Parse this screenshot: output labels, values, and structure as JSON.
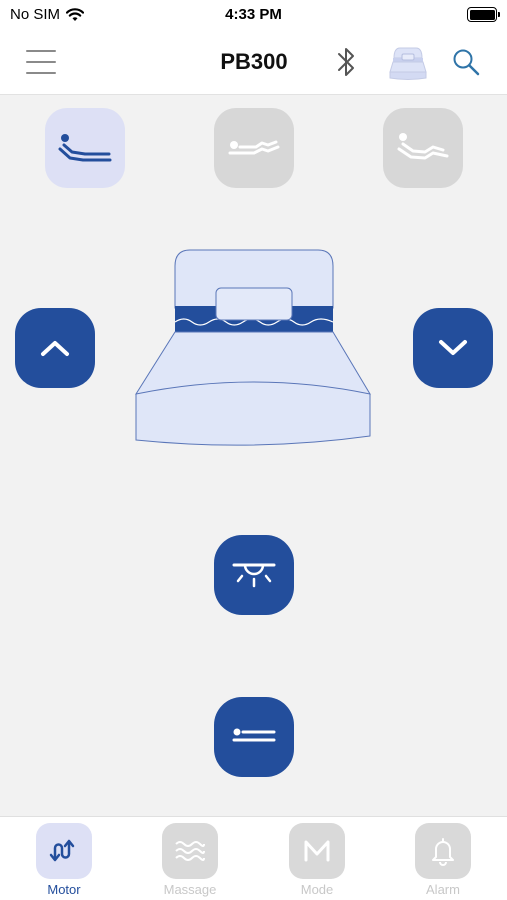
{
  "status_bar": {
    "carrier": "No SIM",
    "time": "4:33 PM",
    "wifi_icon": "wifi-icon",
    "battery_icon": "battery-icon"
  },
  "header": {
    "title": "PB300",
    "menu_icon": "hamburger-icon",
    "bluetooth_icon": "bluetooth-icon",
    "bed_icon": "bed-status-icon",
    "search_icon": "search-icon"
  },
  "presets": [
    {
      "icon": "flat-lying-person-icon",
      "state": "active"
    },
    {
      "icon": "zero-gravity-icon",
      "state": "inactive"
    },
    {
      "icon": "lounge-position-icon",
      "state": "inactive"
    }
  ],
  "controls": {
    "up_icon": "chevron-up-icon",
    "down_icon": "chevron-down-icon",
    "light_icon": "under-bed-light-icon",
    "flat_icon": "flat-position-icon"
  },
  "tabs": [
    {
      "label": "Motor",
      "icon": "motor-icon",
      "active": true
    },
    {
      "label": "Massage",
      "icon": "massage-waves-icon",
      "active": false
    },
    {
      "label": "Mode",
      "icon": "mode-m-icon",
      "active": false
    },
    {
      "label": "Alarm",
      "icon": "bell-icon",
      "active": false
    }
  ],
  "colors": {
    "accent": "#234e9c",
    "active_bg": "#dde0f5",
    "inactive_bg": "#d7d7d7",
    "background": "#f2f2f2"
  }
}
